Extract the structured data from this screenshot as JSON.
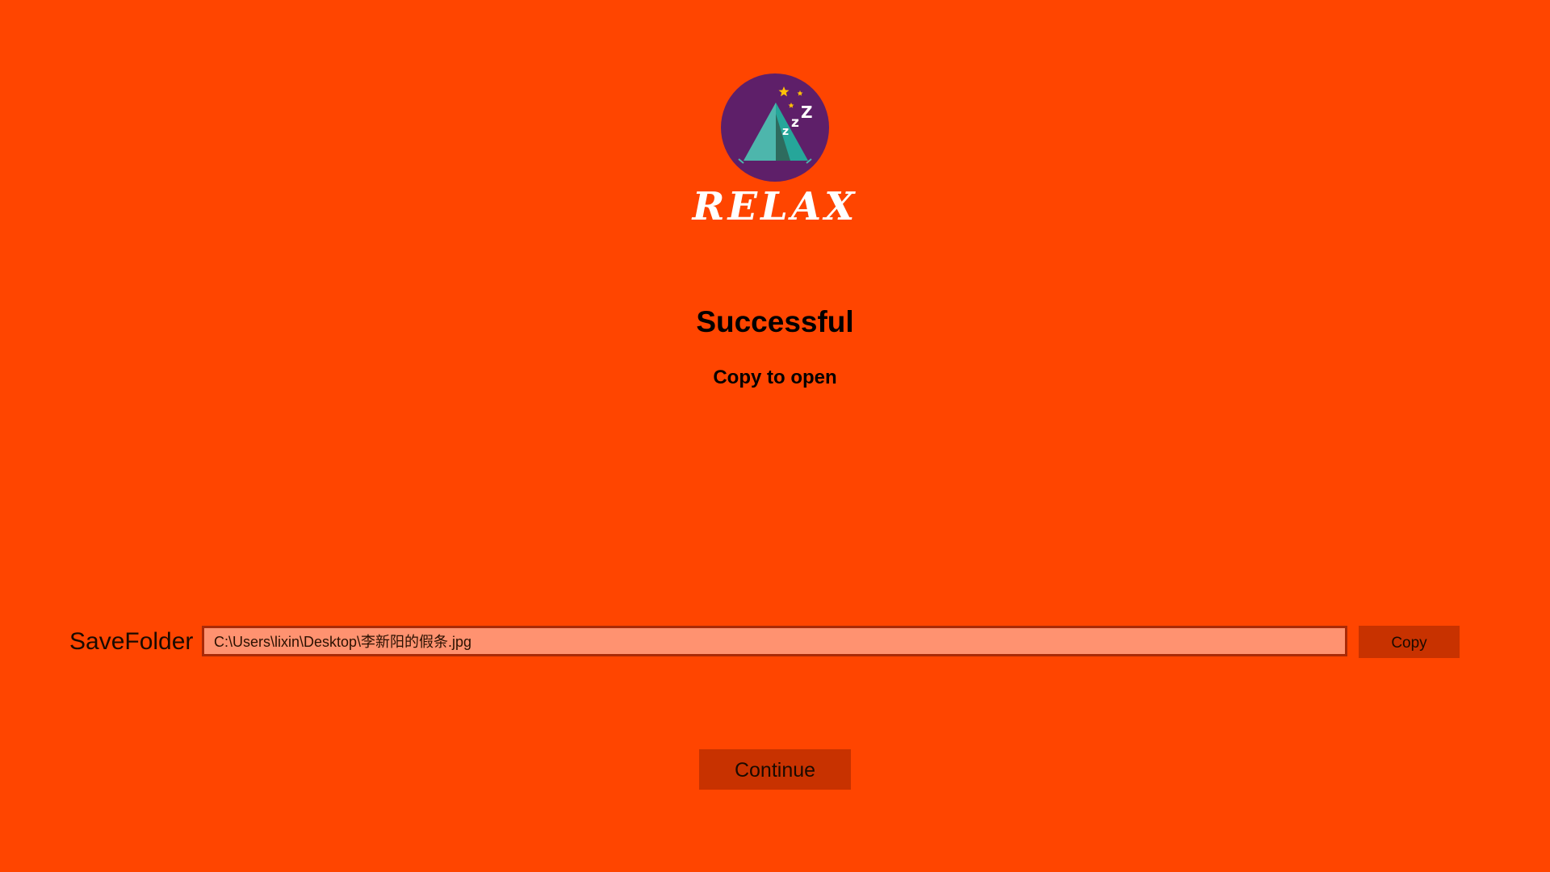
{
  "brand": {
    "logo_icon": "sleeping-tent-logo-icon",
    "name": "RELAX"
  },
  "status": {
    "title": "Successful",
    "subtitle": "Copy to open"
  },
  "save": {
    "label": "SaveFolder",
    "path_value": "C:\\Users\\lixin\\Desktop\\李新阳的假条.jpg",
    "copy_label": "Copy"
  },
  "actions": {
    "continue_label": "Continue"
  },
  "colors": {
    "background": "#FF4500",
    "button": "#C83200",
    "input_fill": "#FF9270",
    "logo_circle": "#5E1F69",
    "tent": "#4DB6AC",
    "moon": "#FFC107"
  }
}
